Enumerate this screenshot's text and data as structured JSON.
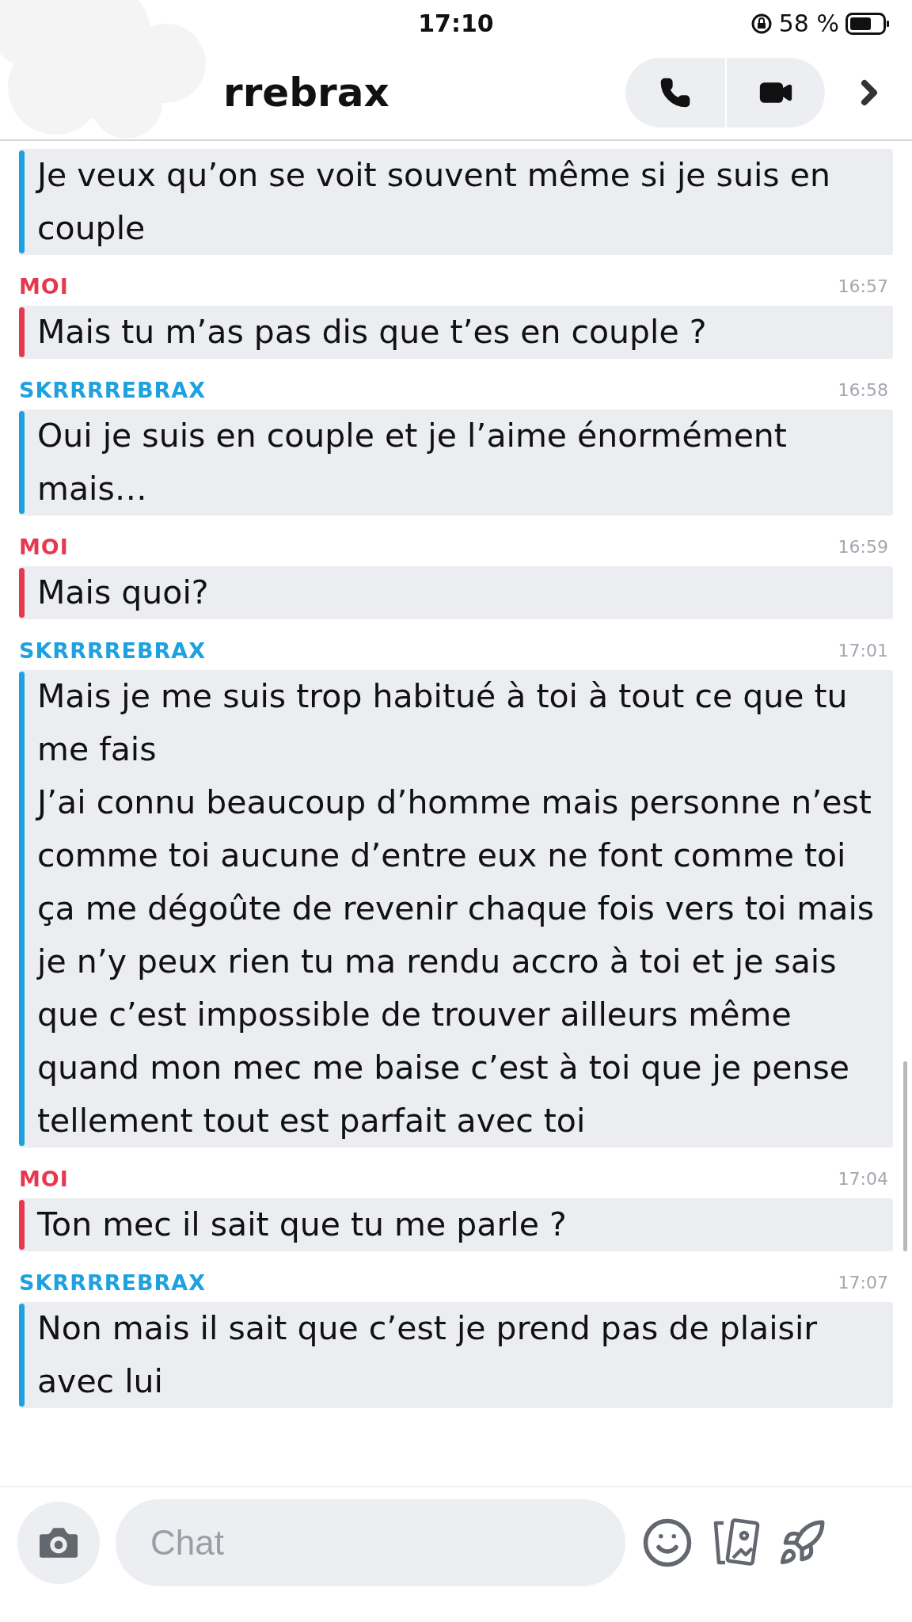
{
  "status_bar": {
    "time": "17:10",
    "battery": "58 %"
  },
  "header": {
    "name": "rrebrax"
  },
  "messages": [
    {
      "kind": "them",
      "text": "Je veux qu’on se voit souvent même si je suis en couple"
    },
    {
      "kind": "me",
      "author": "MOI",
      "time": "16:57",
      "text": "Mais tu m’as pas dis que t’es en couple ?"
    },
    {
      "kind": "them",
      "author": "SKRRRREBRAX",
      "time": "16:58",
      "text": "Oui je suis en couple et je l’aime énormément mais…"
    },
    {
      "kind": "me",
      "author": "MOI",
      "time": "16:59",
      "text": "Mais quoi?"
    },
    {
      "kind": "them",
      "author": "SKRRRREBRAX",
      "time": "17:01",
      "text": "Mais je me suis trop habitué à toi à tout ce que tu me fais\nJ’ai connu beaucoup d’homme mais personne n’est comme toi aucune d’entre eux ne font comme toi ça me dégoûte de revenir chaque fois vers toi mais je n’y peux rien tu ma rendu accro à toi et je sais que c’est impossible de trouver ailleurs même quand mon mec me baise c’est à toi que je pense tellement tout est parfait avec toi"
    },
    {
      "kind": "me",
      "author": "MOI",
      "time": "17:04",
      "text": "Ton mec il sait que tu me parle ?"
    },
    {
      "kind": "them",
      "author": "SKRRRREBRAX",
      "time": "17:07",
      "text": "Non mais il sait que c’est je prend pas de plaisir avec lui"
    }
  ],
  "composer": {
    "placeholder": "Chat"
  }
}
